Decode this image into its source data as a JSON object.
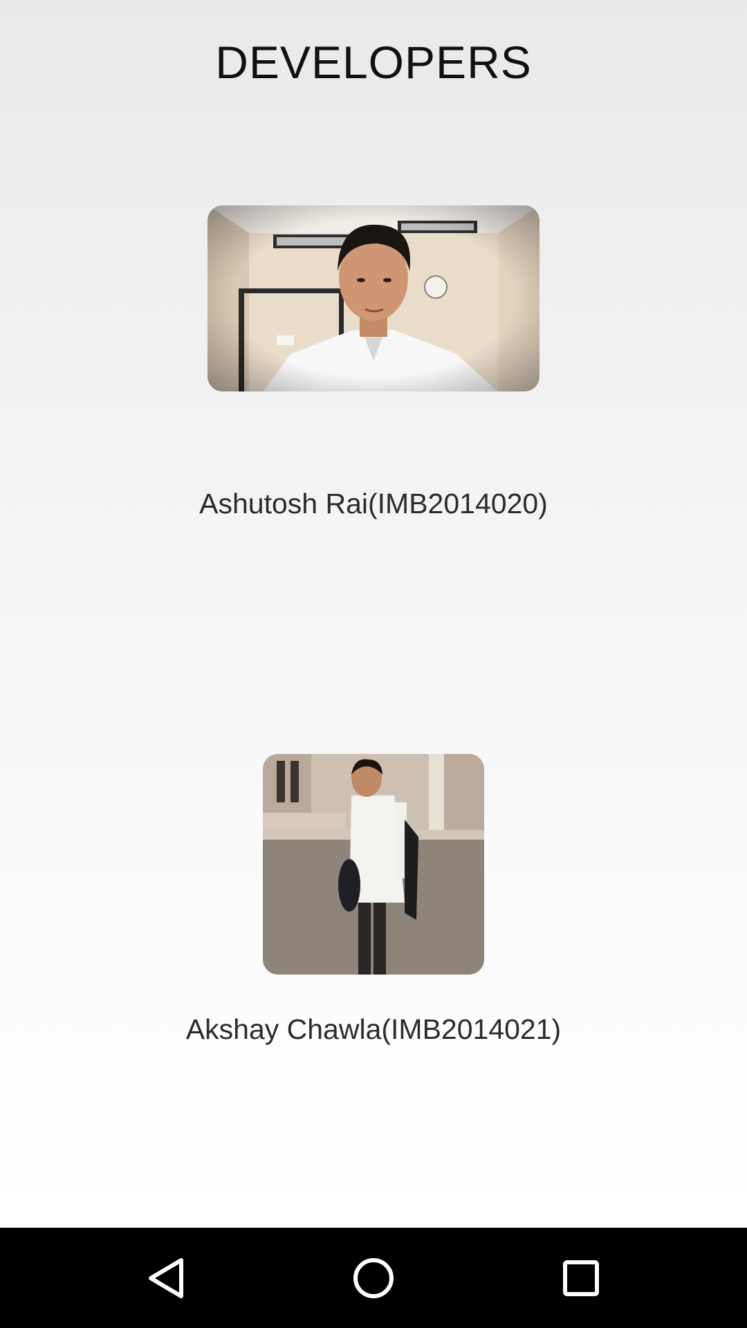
{
  "page": {
    "title": "DEVELOPERS"
  },
  "developers": [
    {
      "name": "Ashutosh Rai(IMB2014020)",
      "photo_alt": "developer-photo"
    },
    {
      "name": "Akshay Chawla(IMB2014021)",
      "photo_alt": "developer-photo"
    }
  ],
  "navbar": {
    "back_icon": "back-triangle-icon",
    "home_icon": "home-circle-icon",
    "recents_icon": "recents-square-icon"
  },
  "colors": {
    "navbar_bg": "#000000",
    "title_text": "#111111",
    "name_text": "#2b2b2b"
  }
}
